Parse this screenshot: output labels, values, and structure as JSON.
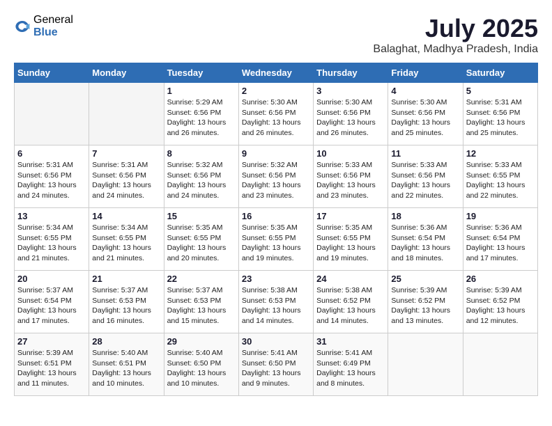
{
  "logo": {
    "general": "General",
    "blue": "Blue"
  },
  "header": {
    "month_year": "July 2025",
    "location": "Balaghat, Madhya Pradesh, India"
  },
  "weekdays": [
    "Sunday",
    "Monday",
    "Tuesday",
    "Wednesday",
    "Thursday",
    "Friday",
    "Saturday"
  ],
  "weeks": [
    [
      {
        "day": "",
        "info": ""
      },
      {
        "day": "",
        "info": ""
      },
      {
        "day": "1",
        "info": "Sunrise: 5:29 AM\nSunset: 6:56 PM\nDaylight: 13 hours\nand 26 minutes."
      },
      {
        "day": "2",
        "info": "Sunrise: 5:30 AM\nSunset: 6:56 PM\nDaylight: 13 hours\nand 26 minutes."
      },
      {
        "day": "3",
        "info": "Sunrise: 5:30 AM\nSunset: 6:56 PM\nDaylight: 13 hours\nand 26 minutes."
      },
      {
        "day": "4",
        "info": "Sunrise: 5:30 AM\nSunset: 6:56 PM\nDaylight: 13 hours\nand 25 minutes."
      },
      {
        "day": "5",
        "info": "Sunrise: 5:31 AM\nSunset: 6:56 PM\nDaylight: 13 hours\nand 25 minutes."
      }
    ],
    [
      {
        "day": "6",
        "info": "Sunrise: 5:31 AM\nSunset: 6:56 PM\nDaylight: 13 hours\nand 24 minutes."
      },
      {
        "day": "7",
        "info": "Sunrise: 5:31 AM\nSunset: 6:56 PM\nDaylight: 13 hours\nand 24 minutes."
      },
      {
        "day": "8",
        "info": "Sunrise: 5:32 AM\nSunset: 6:56 PM\nDaylight: 13 hours\nand 24 minutes."
      },
      {
        "day": "9",
        "info": "Sunrise: 5:32 AM\nSunset: 6:56 PM\nDaylight: 13 hours\nand 23 minutes."
      },
      {
        "day": "10",
        "info": "Sunrise: 5:33 AM\nSunset: 6:56 PM\nDaylight: 13 hours\nand 23 minutes."
      },
      {
        "day": "11",
        "info": "Sunrise: 5:33 AM\nSunset: 6:56 PM\nDaylight: 13 hours\nand 22 minutes."
      },
      {
        "day": "12",
        "info": "Sunrise: 5:33 AM\nSunset: 6:55 PM\nDaylight: 13 hours\nand 22 minutes."
      }
    ],
    [
      {
        "day": "13",
        "info": "Sunrise: 5:34 AM\nSunset: 6:55 PM\nDaylight: 13 hours\nand 21 minutes."
      },
      {
        "day": "14",
        "info": "Sunrise: 5:34 AM\nSunset: 6:55 PM\nDaylight: 13 hours\nand 21 minutes."
      },
      {
        "day": "15",
        "info": "Sunrise: 5:35 AM\nSunset: 6:55 PM\nDaylight: 13 hours\nand 20 minutes."
      },
      {
        "day": "16",
        "info": "Sunrise: 5:35 AM\nSunset: 6:55 PM\nDaylight: 13 hours\nand 19 minutes."
      },
      {
        "day": "17",
        "info": "Sunrise: 5:35 AM\nSunset: 6:55 PM\nDaylight: 13 hours\nand 19 minutes."
      },
      {
        "day": "18",
        "info": "Sunrise: 5:36 AM\nSunset: 6:54 PM\nDaylight: 13 hours\nand 18 minutes."
      },
      {
        "day": "19",
        "info": "Sunrise: 5:36 AM\nSunset: 6:54 PM\nDaylight: 13 hours\nand 17 minutes."
      }
    ],
    [
      {
        "day": "20",
        "info": "Sunrise: 5:37 AM\nSunset: 6:54 PM\nDaylight: 13 hours\nand 17 minutes."
      },
      {
        "day": "21",
        "info": "Sunrise: 5:37 AM\nSunset: 6:53 PM\nDaylight: 13 hours\nand 16 minutes."
      },
      {
        "day": "22",
        "info": "Sunrise: 5:37 AM\nSunset: 6:53 PM\nDaylight: 13 hours\nand 15 minutes."
      },
      {
        "day": "23",
        "info": "Sunrise: 5:38 AM\nSunset: 6:53 PM\nDaylight: 13 hours\nand 14 minutes."
      },
      {
        "day": "24",
        "info": "Sunrise: 5:38 AM\nSunset: 6:52 PM\nDaylight: 13 hours\nand 14 minutes."
      },
      {
        "day": "25",
        "info": "Sunrise: 5:39 AM\nSunset: 6:52 PM\nDaylight: 13 hours\nand 13 minutes."
      },
      {
        "day": "26",
        "info": "Sunrise: 5:39 AM\nSunset: 6:52 PM\nDaylight: 13 hours\nand 12 minutes."
      }
    ],
    [
      {
        "day": "27",
        "info": "Sunrise: 5:39 AM\nSunset: 6:51 PM\nDaylight: 13 hours\nand 11 minutes."
      },
      {
        "day": "28",
        "info": "Sunrise: 5:40 AM\nSunset: 6:51 PM\nDaylight: 13 hours\nand 10 minutes."
      },
      {
        "day": "29",
        "info": "Sunrise: 5:40 AM\nSunset: 6:50 PM\nDaylight: 13 hours\nand 10 minutes."
      },
      {
        "day": "30",
        "info": "Sunrise: 5:41 AM\nSunset: 6:50 PM\nDaylight: 13 hours\nand 9 minutes."
      },
      {
        "day": "31",
        "info": "Sunrise: 5:41 AM\nSunset: 6:49 PM\nDaylight: 13 hours\nand 8 minutes."
      },
      {
        "day": "",
        "info": ""
      },
      {
        "day": "",
        "info": ""
      }
    ]
  ]
}
